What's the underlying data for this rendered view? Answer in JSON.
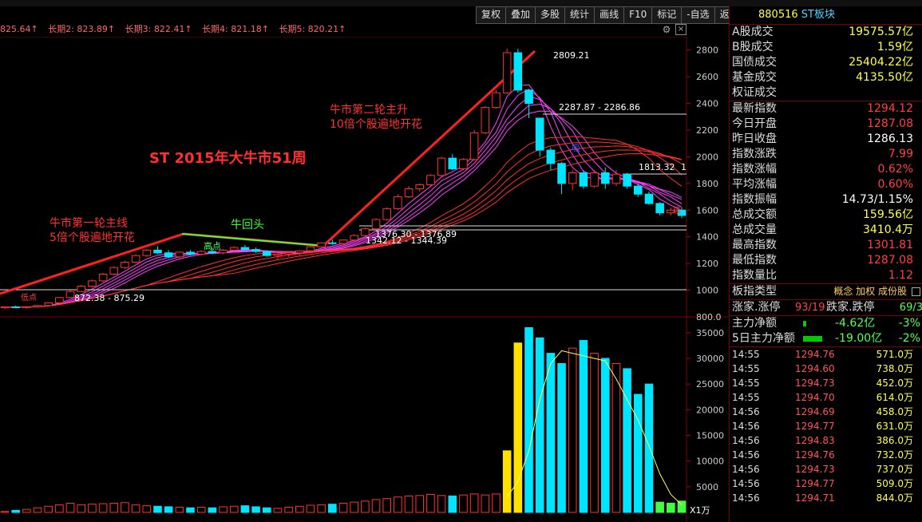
{
  "toolbar": [
    "复权",
    "叠加",
    "多股",
    "统计",
    "画线",
    "F10",
    "标记",
    "-自选",
    "返回"
  ],
  "ma_strip": [
    "825.64↑",
    "长期2: 823.89↑",
    "长期3: 822.41↑",
    "长期4: 821.18↑",
    "长期5: 820.21↑"
  ],
  "chart_labels": {
    "title": "ST   2015年大牛市51周",
    "round1_a": "牛市第一轮主线",
    "round1_b": "5倍个股遍地开花",
    "round2_a": "牛市第二轮主升",
    "round2_b": "10倍个股遍地开花",
    "pullback": "牛回头",
    "peak": "2809.21",
    "hline1": "2287.87 - 2286.86",
    "hline2": "1813.32",
    "hline2_suffix": "1",
    "mid1": "1376.30 - 1376.89",
    "mid2": "1342.12 - 1344.39",
    "low": "872.38 - 875.29",
    "gaodian": "高点",
    "xi_a": "吸",
    "xi_b": "低点",
    "xi_c": "吸",
    "x_unit": "X1万"
  },
  "price_axis": [
    "2800",
    "2600",
    "2400",
    "2200",
    "2000",
    "1800",
    "1600",
    "1400",
    "1200",
    "1000",
    "800.0"
  ],
  "vol_axis": [
    "35000",
    "30000",
    "25000",
    "20000",
    "15000",
    "10000",
    "5000"
  ],
  "colors": {
    "up": "#ff3030",
    "down": "#00e5ff",
    "trend": "#ff2020",
    "pink": "#ff40ff",
    "green": "#40ff40",
    "yellow": "#ffe000"
  },
  "chart_data": {
    "type": "candlestick",
    "price_range": [
      800,
      2900
    ],
    "volume_range": [
      0,
      37000
    ],
    "candles": [
      [
        868,
        880,
        860,
        875
      ],
      [
        875,
        885,
        865,
        870
      ],
      [
        870,
        880,
        862,
        876
      ],
      [
        876,
        890,
        870,
        885
      ],
      [
        885,
        910,
        880,
        905
      ],
      [
        905,
        950,
        900,
        945
      ],
      [
        945,
        1000,
        940,
        990
      ],
      [
        990,
        1040,
        985,
        1030
      ],
      [
        1030,
        1080,
        1020,
        1070
      ],
      [
        1070,
        1130,
        1060,
        1120
      ],
      [
        1120,
        1180,
        1110,
        1170
      ],
      [
        1170,
        1220,
        1160,
        1210
      ],
      [
        1210,
        1270,
        1200,
        1260
      ],
      [
        1260,
        1310,
        1250,
        1300
      ],
      [
        1300,
        1330,
        1270,
        1280
      ],
      [
        1280,
        1300,
        1240,
        1250
      ],
      [
        1250,
        1290,
        1240,
        1285
      ],
      [
        1285,
        1300,
        1260,
        1270
      ],
      [
        1270,
        1300,
        1260,
        1290
      ],
      [
        1290,
        1320,
        1270,
        1280
      ],
      [
        1280,
        1310,
        1270,
        1300
      ],
      [
        1300,
        1330,
        1290,
        1320
      ],
      [
        1320,
        1340,
        1300,
        1305
      ],
      [
        1305,
        1320,
        1280,
        1290
      ],
      [
        1290,
        1300,
        1250,
        1260
      ],
      [
        1260,
        1280,
        1230,
        1270
      ],
      [
        1270,
        1290,
        1250,
        1280
      ],
      [
        1280,
        1300,
        1260,
        1295
      ],
      [
        1295,
        1330,
        1290,
        1325
      ],
      [
        1325,
        1360,
        1320,
        1355
      ],
      [
        1355,
        1380,
        1340,
        1350
      ],
      [
        1350,
        1380,
        1342,
        1376
      ],
      [
        1376,
        1420,
        1370,
        1410
      ],
      [
        1410,
        1470,
        1400,
        1460
      ],
      [
        1460,
        1540,
        1450,
        1530
      ],
      [
        1530,
        1620,
        1520,
        1610
      ],
      [
        1610,
        1720,
        1600,
        1700
      ],
      [
        1700,
        1780,
        1690,
        1760
      ],
      [
        1760,
        1800,
        1740,
        1790
      ],
      [
        1790,
        1870,
        1780,
        1860
      ],
      [
        1860,
        2000,
        1850,
        1990
      ],
      [
        1990,
        2020,
        1900,
        1910
      ],
      [
        1910,
        1990,
        1900,
        1980
      ],
      [
        1980,
        2200,
        1970,
        2180
      ],
      [
        2180,
        2380,
        2170,
        2370
      ],
      [
        2370,
        2500,
        2360,
        2480
      ],
      [
        2480,
        2810,
        2470,
        2780
      ],
      [
        2780,
        2809,
        2480,
        2500
      ],
      [
        2500,
        2500,
        2290,
        2400
      ],
      [
        2290,
        2290,
        2000,
        2050
      ],
      [
        2050,
        2070,
        1900,
        1950
      ],
      [
        1950,
        1960,
        1720,
        1800
      ],
      [
        1800,
        1900,
        1750,
        1880
      ],
      [
        1880,
        1900,
        1760,
        1780
      ],
      [
        1780,
        1900,
        1770,
        1880
      ],
      [
        1880,
        1920,
        1760,
        1800
      ],
      [
        1800,
        1900,
        1780,
        1870
      ],
      [
        1870,
        1880,
        1760,
        1780
      ],
      [
        1780,
        1800,
        1700,
        1720
      ],
      [
        1720,
        1740,
        1640,
        1650
      ],
      [
        1650,
        1660,
        1560,
        1580
      ],
      [
        1580,
        1620,
        1560,
        1600
      ],
      [
        1600,
        1620,
        1540,
        1560
      ]
    ],
    "volume": [
      200,
      400,
      600,
      900,
      1200,
      1500,
      1800,
      1500,
      1600,
      1700,
      1800,
      1900,
      1500,
      1300,
      1200,
      1100,
      1000,
      900,
      1000,
      900,
      1100,
      1200,
      1300,
      1100,
      900,
      800,
      1000,
      1200,
      1400,
      1500,
      1600,
      1800,
      2000,
      2200,
      2500,
      2700,
      3000,
      3200,
      3300,
      3500,
      3300,
      3200,
      3400,
      3600,
      3400,
      3600,
      12000,
      33000,
      36000,
      34000,
      31000,
      29000,
      32000,
      33500,
      31000,
      30000,
      29000,
      28000,
      23000,
      25000,
      2000,
      1800,
      2200
    ],
    "volume_avg": [
      null,
      null,
      null,
      null,
      null,
      null,
      null,
      null,
      null,
      null,
      null,
      null,
      null,
      null,
      null,
      null,
      null,
      null,
      null,
      null,
      null,
      null,
      null,
      null,
      null,
      null,
      null,
      null,
      null,
      null,
      null,
      null,
      null,
      null,
      null,
      null,
      null,
      null,
      null,
      null,
      null,
      null,
      null,
      null,
      null,
      null,
      3000,
      6000,
      12000,
      22000,
      29000,
      31500,
      31000,
      30500,
      30000,
      29500,
      26000,
      22000,
      18000,
      13000,
      7500,
      3500,
      1500
    ]
  },
  "right_panel": {
    "code": "880516",
    "name": "ST板块",
    "stats": [
      {
        "label": "A股成交",
        "value": "19575.57亿",
        "color": "yellow"
      },
      {
        "label": "B股成交",
        "value": "1.59亿",
        "color": "yellow"
      },
      {
        "label": "国债成交",
        "value": "25404.22亿",
        "color": "yellow"
      },
      {
        "label": "基金成交",
        "value": "4135.50亿",
        "color": "yellow"
      },
      {
        "label": "权证成交",
        "value": "",
        "color": "yellow"
      }
    ],
    "index": [
      {
        "label": "最新指数",
        "value": "1294.12",
        "color": "red"
      },
      {
        "label": "今日开盘",
        "value": "1287.08",
        "color": "red"
      },
      {
        "label": "昨日收盘",
        "value": "1286.13",
        "color": "white"
      },
      {
        "label": "指数涨跌",
        "value": "7.99",
        "color": "red"
      },
      {
        "label": "指数涨幅",
        "value": "0.62%",
        "color": "red"
      },
      {
        "label": "平均涨幅",
        "value": "0.60%",
        "color": "red"
      },
      {
        "label": "指数振幅",
        "value": "14.73/1.15%",
        "color": "white"
      },
      {
        "label": "总成交额",
        "value": "159.56亿",
        "color": "yellow"
      },
      {
        "label": "总成交量",
        "value": "3410.4万",
        "color": "yellow"
      },
      {
        "label": "最高指数",
        "value": "1301.81",
        "color": "red"
      },
      {
        "label": "最低指数",
        "value": "1287.08",
        "color": "red"
      },
      {
        "label": "指数量比",
        "value": "1.12",
        "color": "red"
      }
    ],
    "type_row": {
      "label": "板指类型",
      "value": "概念 加权 成份股"
    },
    "limit_row": {
      "l1": "涨家.涨停",
      "v1": "93/19",
      "l2": "跌家.跌停",
      "v2": "69/3"
    },
    "flow": [
      {
        "label": "主力净额",
        "value": "-4.62亿",
        "pct": "-3%"
      },
      {
        "label": "5日主力净额",
        "value": "-19.00亿",
        "pct": "-2%"
      }
    ],
    "ticks": [
      [
        "14:55",
        "1294.76",
        "571.0万"
      ],
      [
        "14:55",
        "1294.60",
        "738.0万"
      ],
      [
        "14:55",
        "1294.73",
        "452.0万"
      ],
      [
        "14:55",
        "1294.70",
        "614.0万"
      ],
      [
        "14:56",
        "1294.69",
        "458.0万"
      ],
      [
        "14:56",
        "1294.77",
        "631.0万"
      ],
      [
        "14:56",
        "1294.83",
        "386.0万"
      ],
      [
        "14:56",
        "1294.76",
        "732.0万"
      ],
      [
        "14:56",
        "1294.73",
        "737.0万"
      ],
      [
        "14:56",
        "1294.77",
        "509.0万"
      ],
      [
        "14:56",
        "1294.71",
        "844.0万"
      ]
    ]
  }
}
